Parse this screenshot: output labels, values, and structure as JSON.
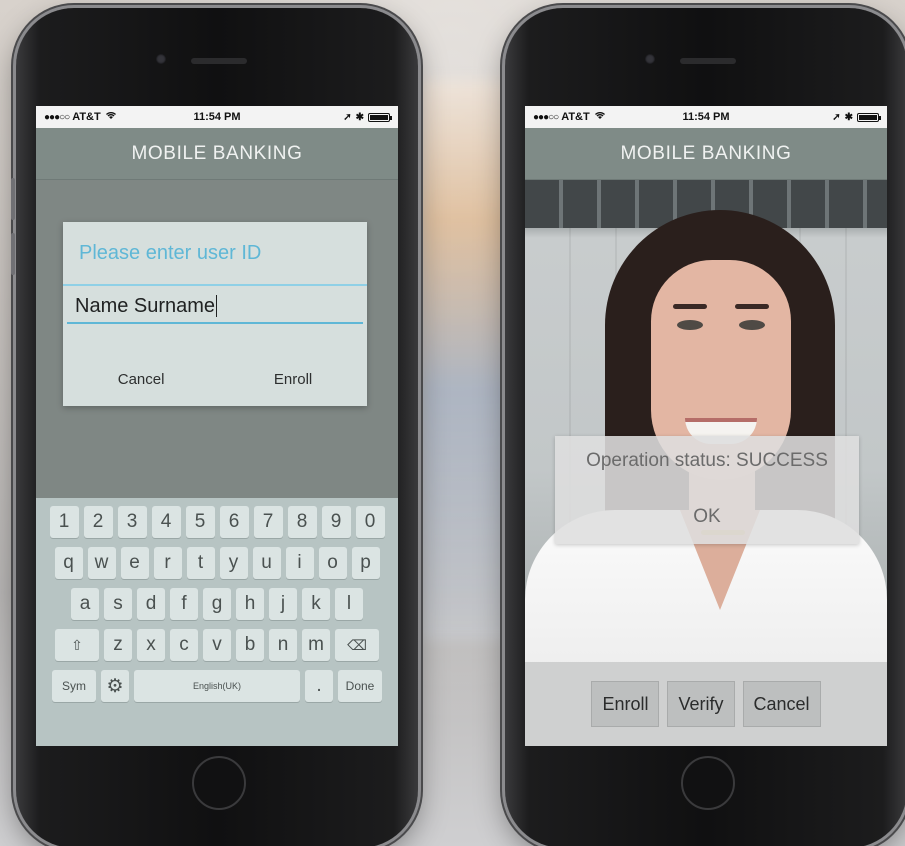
{
  "status_bar": {
    "signal": "●●●○○",
    "carrier": "AT&T",
    "wifi_icon": "wifi-icon",
    "time": "11:54 PM",
    "location_icon": "location-arrow-icon",
    "bluetooth_icon": "bluetooth-icon",
    "battery_icon": "battery-icon"
  },
  "left_phone": {
    "app_title": "MOBILE BANKING",
    "dialog": {
      "placeholder": "Please enter user ID",
      "input_value": "Name Surname",
      "cancel_label": "Cancel",
      "enroll_label": "Enroll"
    },
    "keyboard": {
      "row1": [
        "1",
        "2",
        "3",
        "4",
        "5",
        "6",
        "7",
        "8",
        "9",
        "0"
      ],
      "row2": [
        "q",
        "w",
        "e",
        "r",
        "t",
        "y",
        "u",
        "i",
        "o",
        "p"
      ],
      "row3": [
        "a",
        "s",
        "d",
        "f",
        "g",
        "h",
        "j",
        "k",
        "l"
      ],
      "row4": [
        "z",
        "x",
        "c",
        "v",
        "b",
        "n",
        "m"
      ],
      "shift_glyph": "⇧",
      "backspace_glyph": "⌫",
      "sym_label": "Sym",
      "settings_glyph": "⚙",
      "space_label": "English(UK)",
      "period_label": ".",
      "done_label": "Done"
    }
  },
  "right_phone": {
    "app_title": "MOBILE BANKING",
    "status_dialog": {
      "text": "Operation status: SUCCESS",
      "ok_label": "OK"
    },
    "actions": {
      "enroll": "Enroll",
      "verify": "Verify",
      "cancel": "Cancel"
    }
  }
}
